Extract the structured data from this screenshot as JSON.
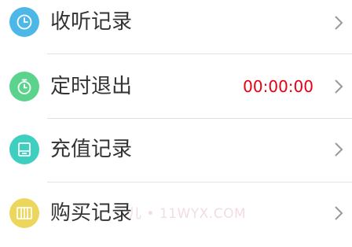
{
  "colors": {
    "listen_icon_bg": "#4db8e8",
    "timer_icon_bg": "#5bd38c",
    "recharge_icon_bg": "#3fcfc0",
    "purchase_icon_bg": "#ecd65b",
    "timer_value": "#e60012",
    "chevron": "#999999"
  },
  "menu": {
    "items": [
      {
        "label": "收听记录",
        "icon": "clock-icon"
      },
      {
        "label": "定时退出",
        "icon": "stopwatch-icon",
        "value": "00:00:00"
      },
      {
        "label": "充值记录",
        "icon": "recharge-icon"
      },
      {
        "label": "购买记录",
        "icon": "purchase-icon"
      }
    ]
  },
  "watermark": "儿 • 11WYX.COM"
}
